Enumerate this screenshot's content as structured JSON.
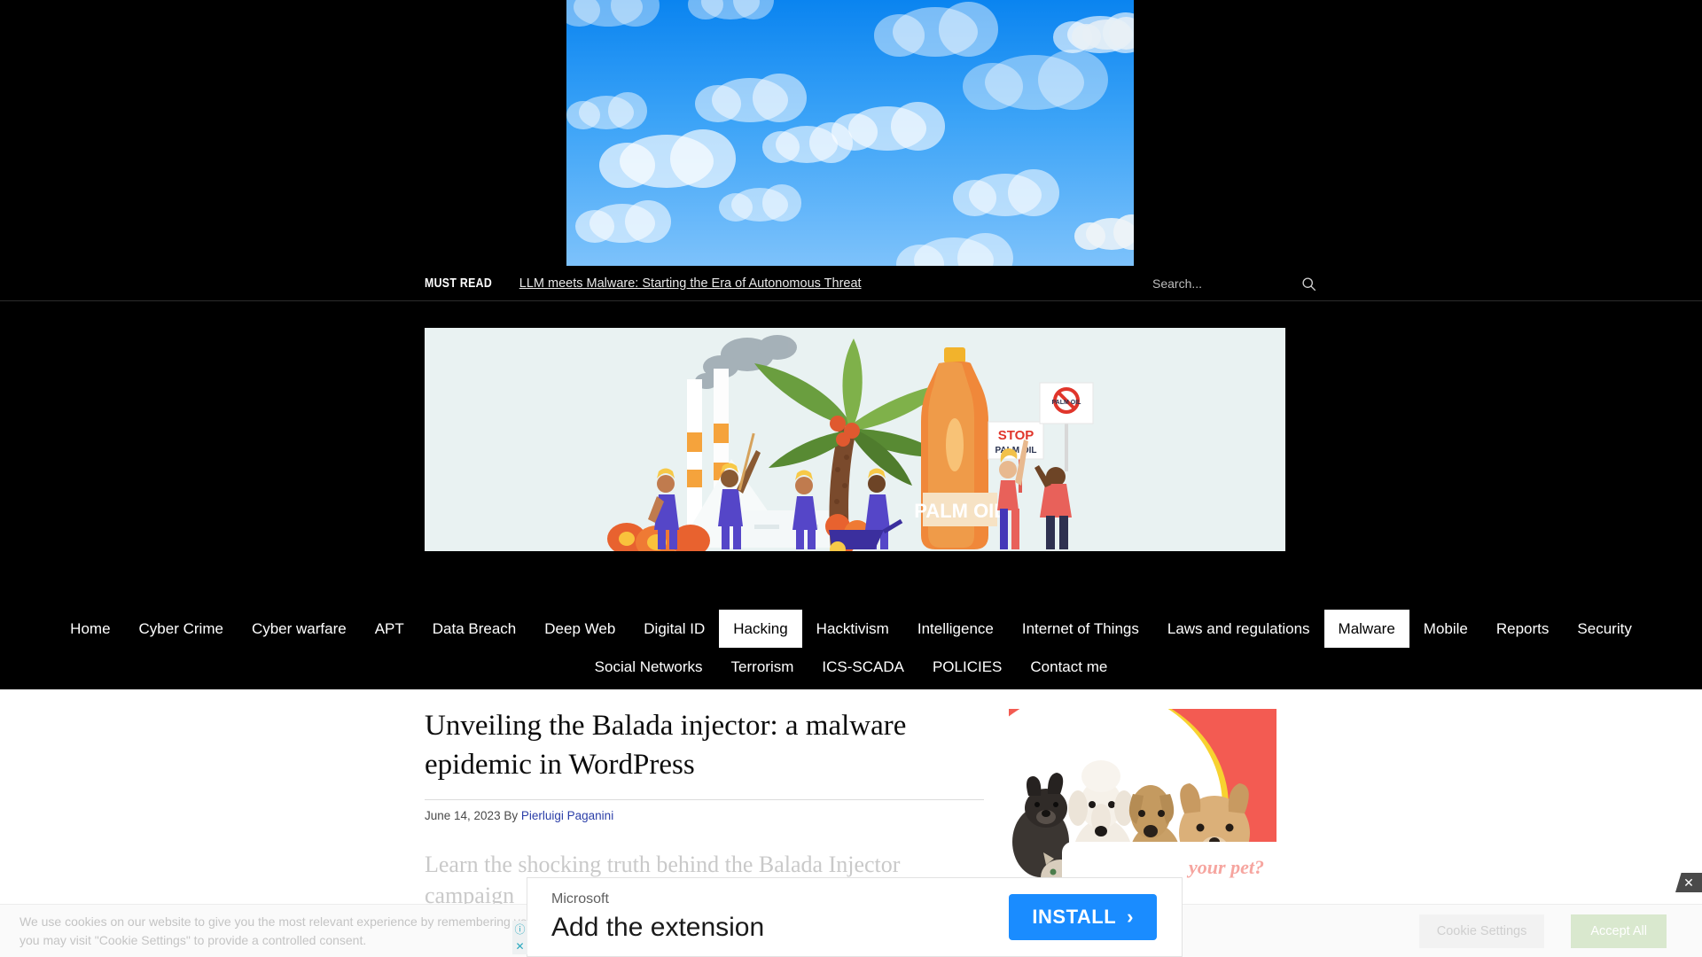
{
  "mustread": {
    "label": "MUST READ",
    "headline": "LLM meets Malware: Starting the Era of Autonomous Threat"
  },
  "search": {
    "placeholder": "Search...",
    "value": "",
    "icon": "search-icon"
  },
  "nav": {
    "row1": [
      {
        "label": "Home",
        "active": false
      },
      {
        "label": "Cyber Crime",
        "active": false
      },
      {
        "label": "Cyber warfare",
        "active": false
      },
      {
        "label": "APT",
        "active": false
      },
      {
        "label": "Data Breach",
        "active": false
      },
      {
        "label": "Deep Web",
        "active": false
      },
      {
        "label": "Digital ID",
        "active": false
      },
      {
        "label": "Hacking",
        "active": true
      },
      {
        "label": "Hacktivism",
        "active": false
      },
      {
        "label": "Intelligence",
        "active": false
      },
      {
        "label": "Internet of Things",
        "active": false
      },
      {
        "label": "Laws and regulations",
        "active": false
      },
      {
        "label": "Malware",
        "active": true
      },
      {
        "label": "Mobile",
        "active": false
      },
      {
        "label": "Reports",
        "active": false
      },
      {
        "label": "Security",
        "active": false
      }
    ],
    "row2": [
      {
        "label": "Social Networks",
        "active": false
      },
      {
        "label": "Terrorism",
        "active": false
      },
      {
        "label": "ICS-SCADA",
        "active": false
      },
      {
        "label": "POLICIES",
        "active": false
      },
      {
        "label": "Contact me",
        "active": false
      }
    ]
  },
  "article": {
    "title": "Unveiling the Balada injector: a malware epidemic in WordPress",
    "date": "June 14, 2023",
    "by_prefix": "By",
    "author": "Pierluigi Paganini",
    "subhead": "Learn the shocking truth behind the Balada Injector campaign"
  },
  "ads": {
    "top_banner": {
      "name": "sky-clouds-banner"
    },
    "palm_banner": {
      "name": "palm-oil-banner",
      "product_label": "PALM OIL",
      "sign_stop": "STOP",
      "sign_stop_sub": "PALM OIL",
      "sign_no": "PALM OIL"
    },
    "pet_ad": {
      "name": "pet-ad",
      "text": "your pet?"
    },
    "microsoft": {
      "brand": "Microsoft",
      "title": "Add the extension",
      "cta": "INSTALL",
      "cta_arrow": "›",
      "info_icon": "ⓘ",
      "close_icon": "✕"
    },
    "close_tab_icon": "✕"
  },
  "cookie": {
    "line1": "We use cookies on our website to give you the most relevant experience by remembering your preferences and repeat visits. By clicking “Accept All”, you consent to the use of ALL the cookies. However,",
    "line2": "you may visit \"Cookie Settings\" to provide a controlled consent.",
    "settings_label": "Cookie Settings",
    "accept_label": "Accept All"
  },
  "colors": {
    "nav_bg": "#000000",
    "nav_active_bg": "#ffffff",
    "link": "#2b3ea8",
    "install_btn": "#1a8cff",
    "accept_btn": "#d9e8ce",
    "pet_bg": "#f35b52"
  }
}
